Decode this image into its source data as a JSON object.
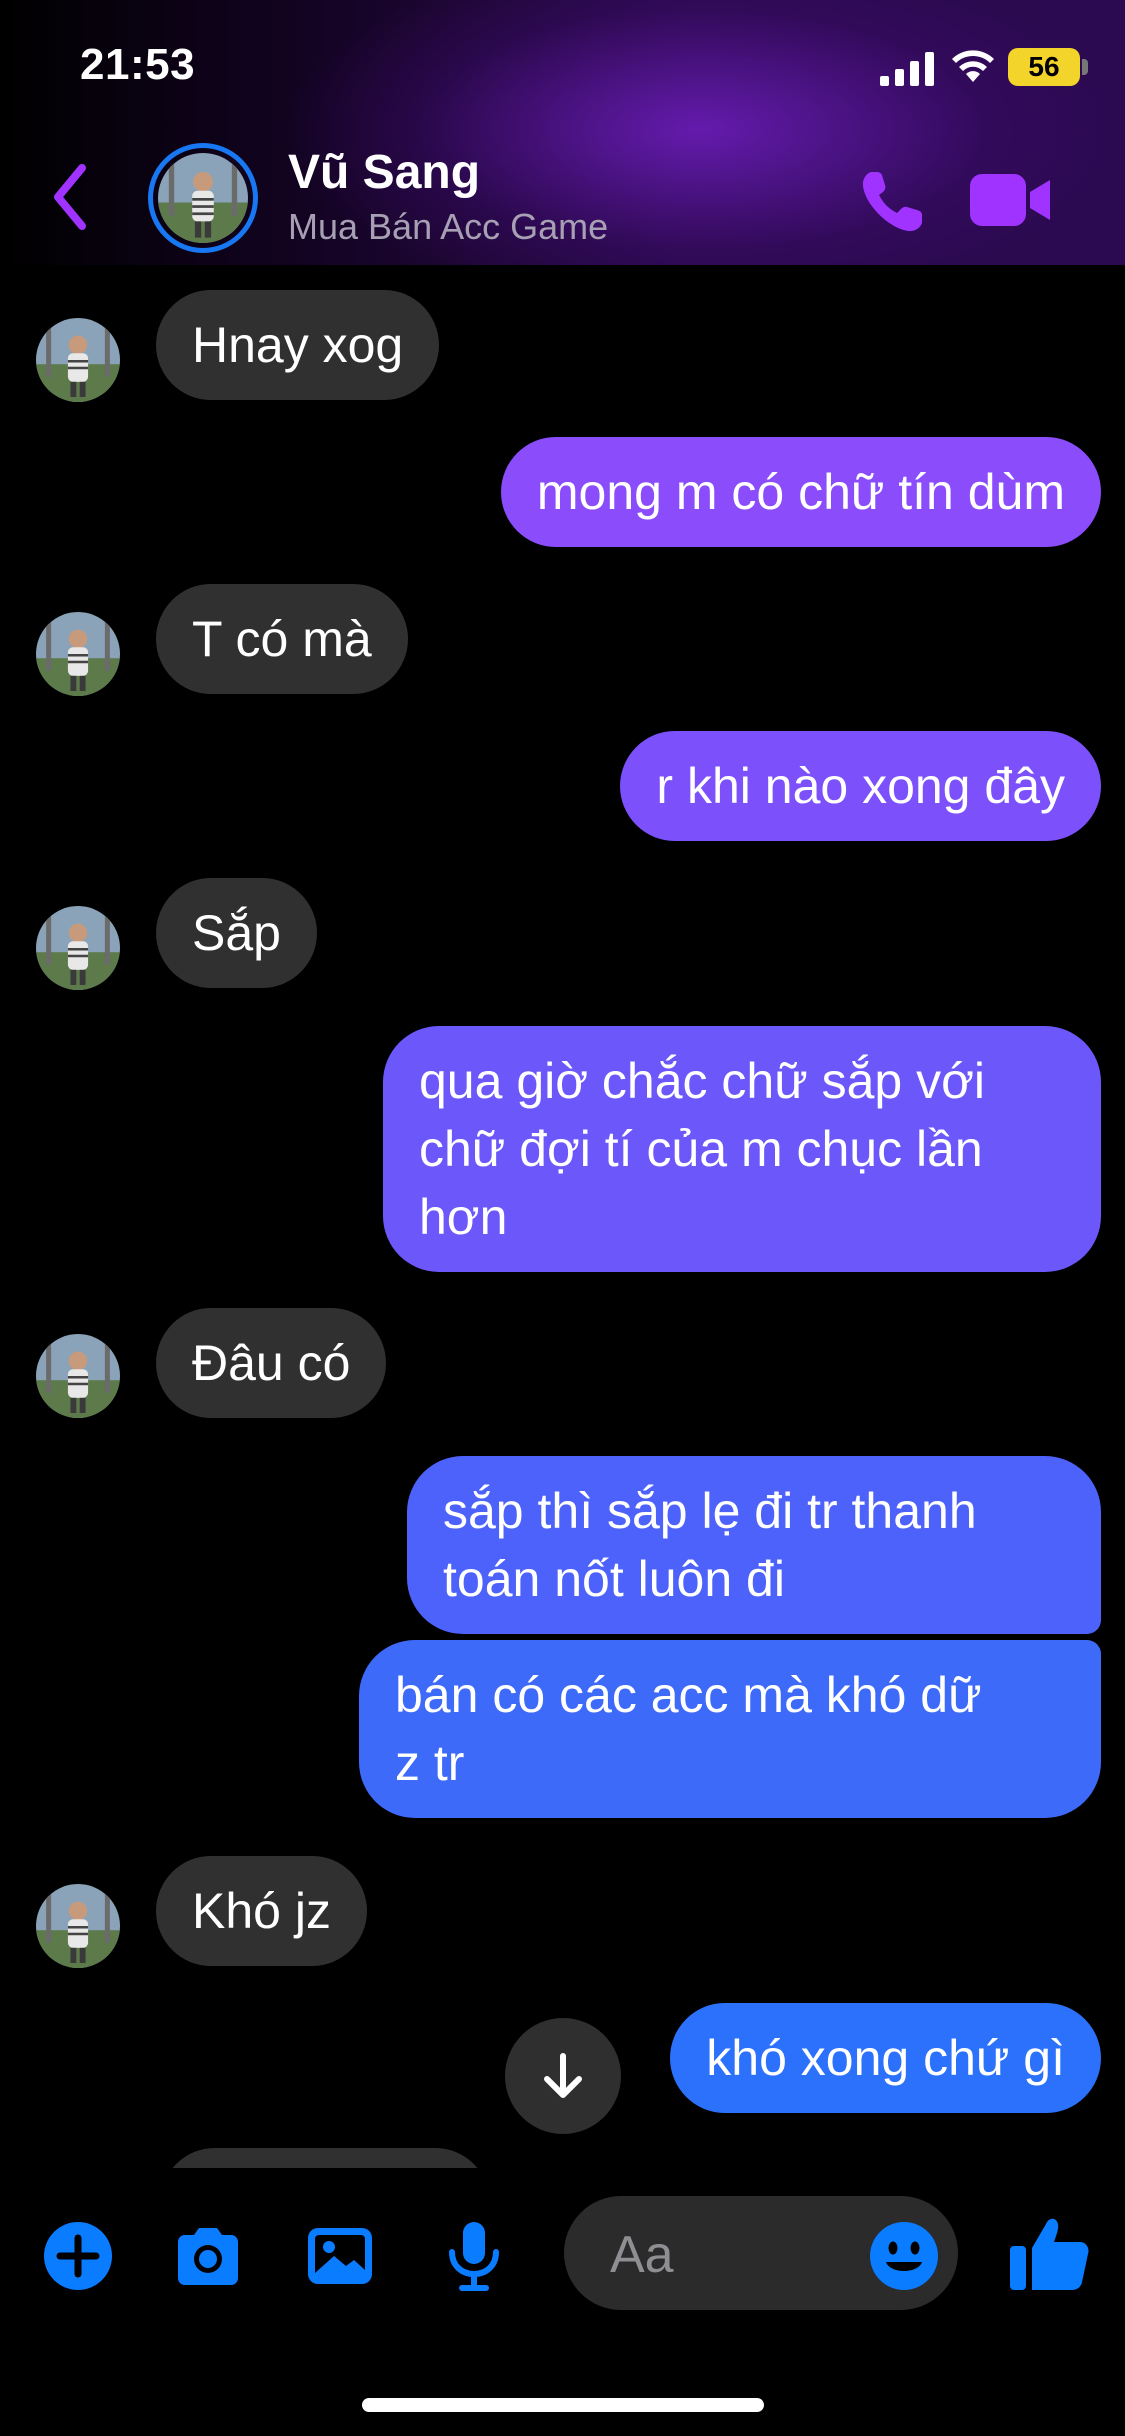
{
  "status_bar": {
    "time": "21:53",
    "battery": "56"
  },
  "header": {
    "name": "Vũ Sang",
    "subtitle": "Mua Bán Acc Game"
  },
  "messages": [
    {
      "side": "in",
      "text": "Hnay xog"
    },
    {
      "side": "out",
      "text": "mong m có chữ tín dùm"
    },
    {
      "side": "in",
      "text": "T có mà"
    },
    {
      "side": "out",
      "text": "r khi nào xong đây"
    },
    {
      "side": "in",
      "text": "Sắp"
    },
    {
      "side": "out",
      "lines": [
        "qua giờ chắc chữ sắp với",
        "chữ đợi tí của m chục lần",
        "hơn"
      ]
    },
    {
      "side": "in",
      "text": "Đâu có"
    },
    {
      "side": "out",
      "lines": [
        "sắp thì sắp lẹ đi tr thanh",
        "toán nốt luôn đi"
      ]
    },
    {
      "side": "out",
      "lines": [
        "bán có các acc mà khó dữ",
        "z tr"
      ]
    },
    {
      "side": "in",
      "text": "Khó jz"
    },
    {
      "side": "out",
      "text": "khó xong chứ gì"
    }
  ],
  "composer": {
    "placeholder": "Aa"
  },
  "colors": {
    "accent_purple": "#a033ff",
    "messenger_blue": "#0a7cff",
    "incoming_bubble": "#303030"
  },
  "icons": {
    "back": "chevron-left-icon",
    "call": "phone-icon",
    "video": "video-camera-icon",
    "add": "plus-circle-icon",
    "camera": "camera-icon",
    "gallery": "image-icon",
    "mic": "microphone-icon",
    "emoji": "smiley-icon",
    "like": "thumbs-up-icon",
    "scroll": "arrow-down-icon"
  }
}
